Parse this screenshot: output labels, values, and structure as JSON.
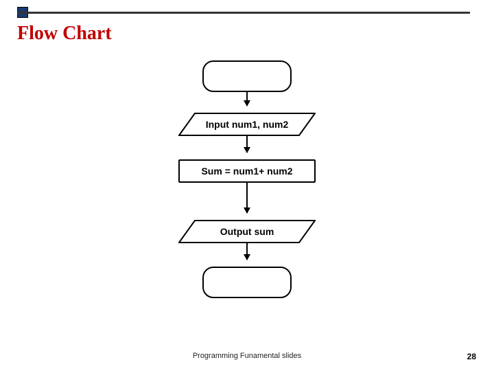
{
  "title": "Flow Chart",
  "flowchart": {
    "nodes": {
      "start": {
        "label": ""
      },
      "input": {
        "label": "Input num1, num2"
      },
      "process": {
        "label": "Sum = num1+ num2"
      },
      "output": {
        "label": "Output sum"
      },
      "end": {
        "label": ""
      }
    }
  },
  "footer": "Programming Funamental slides",
  "page_number": "28"
}
